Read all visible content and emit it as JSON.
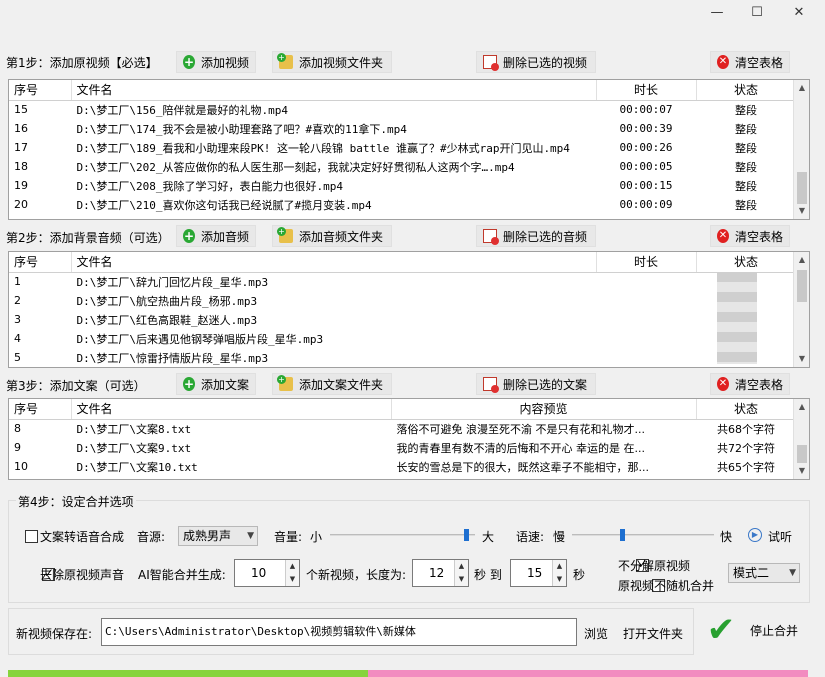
{
  "window": {
    "minimize": "—",
    "maximize": "☐",
    "close": "✕"
  },
  "step1": {
    "label": "第1步：添加原视频【必选】",
    "btn_add": "添加视频",
    "btn_add_folder": "添加视频文件夹",
    "btn_delete": "删除已选的视频",
    "btn_clear": "清空表格",
    "columns": [
      "序号",
      "文件名",
      "时长",
      "状态"
    ],
    "rows": [
      {
        "num": "15",
        "file": "D:\\梦工厂\\156_陪伴就是最好的礼物.mp4",
        "duration": "00:00:07",
        "status": "整段"
      },
      {
        "num": "16",
        "file": "D:\\梦工厂\\174_我不会是被小助理套路了吧？#喜欢的11拿下.mp4",
        "duration": "00:00:39",
        "status": "整段"
      },
      {
        "num": "17",
        "file": "D:\\梦工厂\\189_看我和小助理来段PK! 这一轮八段锦 battle 谁赢了？#少林式rap开门见山.mp4",
        "duration": "00:00:26",
        "status": "整段"
      },
      {
        "num": "18",
        "file": "D:\\梦工厂\\202_从答应做你的私人医生那一刻起，我就决定好好贯彻私人这两个字….mp4",
        "duration": "00:00:05",
        "status": "整段"
      },
      {
        "num": "19",
        "file": "D:\\梦工厂\\208_我除了学习好，表白能力也很好.mp4",
        "duration": "00:00:15",
        "status": "整段"
      },
      {
        "num": "20",
        "file": "D:\\梦工厂\\210_喜欢你这句话我已经说腻了#揽月变装.mp4",
        "duration": "00:00:09",
        "status": "整段"
      }
    ]
  },
  "step2": {
    "label": "第2步：添加背景音频（可选）",
    "btn_add": "添加音频",
    "btn_add_folder": "添加音频文件夹",
    "btn_delete": "删除已选的音频",
    "btn_clear": "清空表格",
    "columns": [
      "序号",
      "文件名",
      "时长",
      "状态"
    ],
    "rows": [
      {
        "num": "1",
        "file": "D:\\梦工厂\\辞九门回忆片段_星华.mp3"
      },
      {
        "num": "2",
        "file": "D:\\梦工厂\\航空热曲片段_杨邪.mp3"
      },
      {
        "num": "3",
        "file": "D:\\梦工厂\\红色高跟鞋_赵迷人.mp3"
      },
      {
        "num": "4",
        "file": "D:\\梦工厂\\后来遇见他钢琴弹唱版片段_星华.mp3"
      },
      {
        "num": "5",
        "file": "D:\\梦工厂\\惊雷抒情版片段_星华.mp3"
      }
    ]
  },
  "step3": {
    "label": "第3步：添加文案（可选）",
    "btn_add": "添加文案",
    "btn_add_folder": "添加文案文件夹",
    "btn_delete": "删除已选的文案",
    "btn_clear": "清空表格",
    "columns": [
      "序号",
      "文件名",
      "内容预览",
      "状态"
    ],
    "rows": [
      {
        "num": "8",
        "file": "D:\\梦工厂\\文案8.txt",
        "preview": "落俗不可避免 浪漫至死不渝 不是只有花和礼物才...",
        "status": "共68个字符"
      },
      {
        "num": "9",
        "file": "D:\\梦工厂\\文案9.txt",
        "preview": "我的青春里有数不清的后悔和不开心 幸运的是 在...",
        "status": "共72个字符"
      },
      {
        "num": "10",
        "file": "D:\\梦工厂\\文案10.txt",
        "preview": "长安的雪总是下的很大，既然这辈子不能相守，那...",
        "status": "共65个字符"
      }
    ]
  },
  "step4": {
    "label": "第4步：设定合并选项",
    "tts_label": "文案转语音合成",
    "voice_label": "音源:",
    "voice_value": "成熟男声",
    "volume_label": "音量:",
    "volume_min": "小",
    "volume_max": "大",
    "speed_label": "语速:",
    "speed_min": "慢",
    "speed_max": "快",
    "preview_label": "试听",
    "remove_audio_label": "去除原视频声音",
    "ai_label": "AI智能合并生成:",
    "count_value": "10",
    "count_unit": "个新视频，长度为:",
    "len_min": "12",
    "to": "秒 到",
    "len_max": "15",
    "sec": "秒",
    "no_split_label": "不分解原视频",
    "no_random_label": "原视频不随机合并",
    "mode_value": "模式二",
    "volume_level": 0.96,
    "speed_level": 0.35
  },
  "output": {
    "save_label": "新视频保存在:",
    "save_path": "C:\\Users\\Administrator\\Desktop\\视频剪辑软件\\新媒体",
    "browse": "浏览",
    "open_folder": "打开文件夹",
    "stop": "停止合并"
  },
  "colors": {
    "progress_green": "#86d43c",
    "progress_pink": "#f28cc0",
    "check_green": "#28a030"
  }
}
